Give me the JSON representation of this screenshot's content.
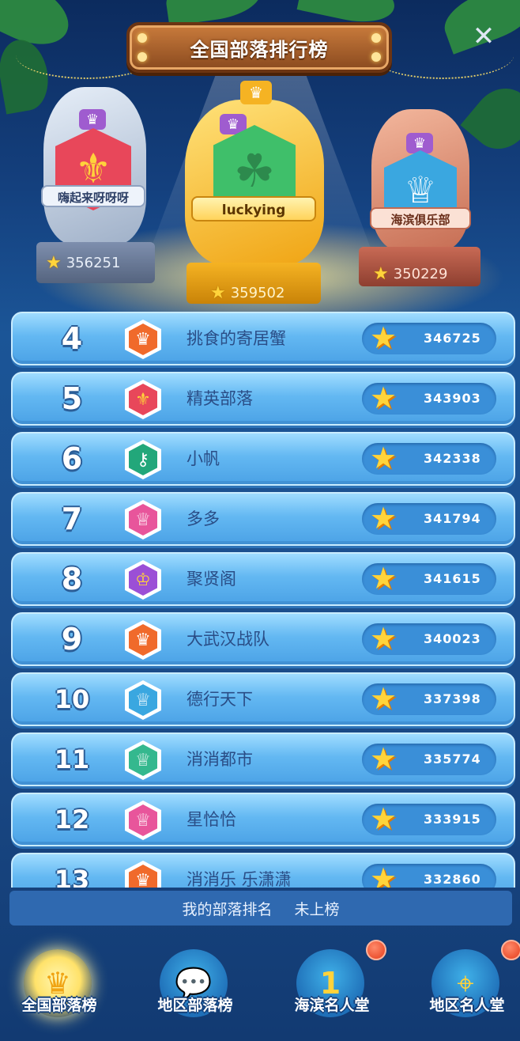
{
  "title": "全国部落排行榜",
  "close_icon": "close-icon",
  "podium": {
    "first": {
      "name": "luckying",
      "score": "359502",
      "badge_icon": "clover-icon",
      "badge_color": "#3fbf6a"
    },
    "second": {
      "name": "嗨起来呀呀呀",
      "score": "356251",
      "badge_icon": "fleur-de-lis-icon",
      "badge_color": "#e8475a"
    },
    "third": {
      "name": "海滨俱乐部",
      "score": "350229",
      "badge_icon": "crown-icon",
      "badge_color": "#3aa7e0"
    }
  },
  "rankings": [
    {
      "rank": "4",
      "name": "挑食的寄居蟹",
      "score": "346725",
      "icon": "crown-icon",
      "color": "#f06a2b"
    },
    {
      "rank": "5",
      "name": "精英部落",
      "score": "343903",
      "icon": "fleur-de-lis-icon",
      "color": "#e8475a"
    },
    {
      "rank": "6",
      "name": "小帆",
      "score": "342338",
      "icon": "key-icon",
      "color": "#22a77a"
    },
    {
      "rank": "7",
      "name": "多多",
      "score": "341794",
      "icon": "trophy-icon",
      "color": "#e8559b"
    },
    {
      "rank": "8",
      "name": "聚贤阁",
      "score": "341615",
      "icon": "king-crown-icon",
      "color": "#9b4fd6"
    },
    {
      "rank": "9",
      "name": "大武汉战队",
      "score": "340023",
      "icon": "crown-icon",
      "color": "#f06a2b"
    },
    {
      "rank": "10",
      "name": "德行天下",
      "score": "337398",
      "icon": "crown-icon",
      "color": "#3aa7e0"
    },
    {
      "rank": "11",
      "name": "消消都市",
      "score": "335774",
      "icon": "wing-crown-icon",
      "color": "#34b88e"
    },
    {
      "rank": "12",
      "name": "星恰恰",
      "score": "333915",
      "icon": "trophy-icon",
      "color": "#e8559b"
    },
    {
      "rank": "13",
      "name": "消消乐 乐潇潇",
      "score": "332860",
      "icon": "crown-icon",
      "color": "#f06a2b"
    }
  ],
  "my_rank": {
    "label": "我的部落排名",
    "value": "未上榜"
  },
  "tabs": [
    {
      "label": "全国部落榜",
      "icon": "crown-icon",
      "active": true,
      "badge": false
    },
    {
      "label": "地区部落榜",
      "icon": "chat-icon",
      "active": false,
      "badge": false
    },
    {
      "label": "海滨名人堂",
      "icon": "number-one-icon",
      "active": false,
      "badge": true
    },
    {
      "label": "地区名人堂",
      "icon": "map-pin-icon",
      "active": false,
      "badge": true
    }
  ],
  "colors": {
    "gold": "#f5b323",
    "silver": "#b9c7dc",
    "bronze": "#d9826a",
    "row_bg": "#63b8f2",
    "score_pill": "#3a8fd8"
  }
}
